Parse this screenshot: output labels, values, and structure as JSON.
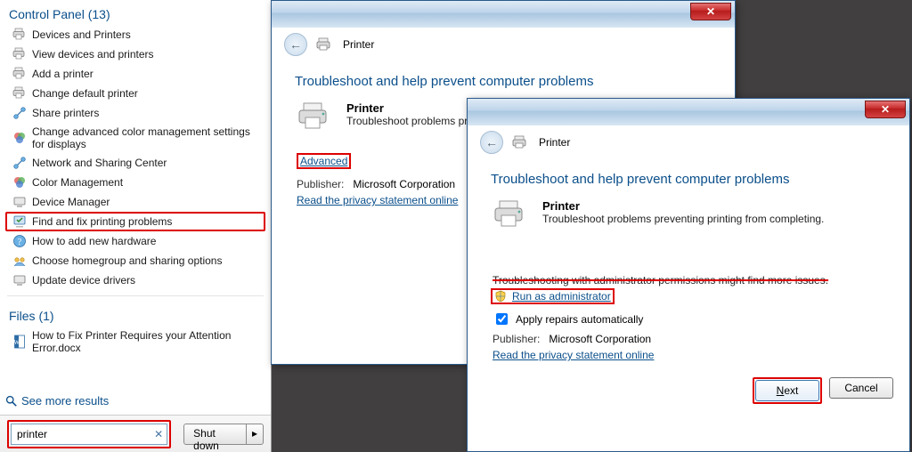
{
  "start": {
    "cp_header": "Control Panel (13)",
    "items": [
      {
        "label": "Devices and Printers",
        "icon": "printers-icon"
      },
      {
        "label": "View devices and printers",
        "icon": "printers-icon"
      },
      {
        "label": "Add a printer",
        "icon": "printers-icon"
      },
      {
        "label": "Change default printer",
        "icon": "printers-icon"
      },
      {
        "label": "Share printers",
        "icon": "network-icon"
      },
      {
        "label": "Change advanced color management settings for displays",
        "icon": "color-icon"
      },
      {
        "label": "Network and Sharing Center",
        "icon": "network-icon"
      },
      {
        "label": "Color Management",
        "icon": "color-icon"
      },
      {
        "label": "Device Manager",
        "icon": "device-icon"
      },
      {
        "label": "Find and fix printing problems",
        "icon": "troubleshoot-icon",
        "hl": true
      },
      {
        "label": "How to add new hardware",
        "icon": "help-icon"
      },
      {
        "label": "Choose homegroup and sharing options",
        "icon": "homegroup-icon"
      },
      {
        "label": "Update device drivers",
        "icon": "device-icon"
      }
    ],
    "files_header": "Files (1)",
    "files": [
      {
        "label": "How to Fix Printer Requires your Attention Error.docx",
        "icon": "docx-icon"
      }
    ],
    "see_more": "See more results",
    "search_value": "printer",
    "shutdown": "Shut down"
  },
  "win1": {
    "crumb": "Printer",
    "heading": "Troubleshoot and help prevent computer problems",
    "title": "Printer",
    "sub": "Troubleshoot problems preve",
    "advanced": "Advanced",
    "publisher_lbl": "Publisher:",
    "publisher_val": "Microsoft Corporation",
    "privacy": "Read the privacy statement online"
  },
  "win2": {
    "crumb": "Printer",
    "heading": "Troubleshoot and help prevent computer problems",
    "title": "Printer",
    "sub": "Troubleshoot problems preventing printing from completing.",
    "notice": "Troubleshooting with administrator permissions might find more issues.",
    "runas": "Run as administrator",
    "apply": "Apply repairs automatically",
    "publisher_lbl": "Publisher:",
    "publisher_val": "Microsoft Corporation",
    "privacy": "Read the privacy statement online",
    "next": "Next",
    "cancel": "Cancel"
  }
}
